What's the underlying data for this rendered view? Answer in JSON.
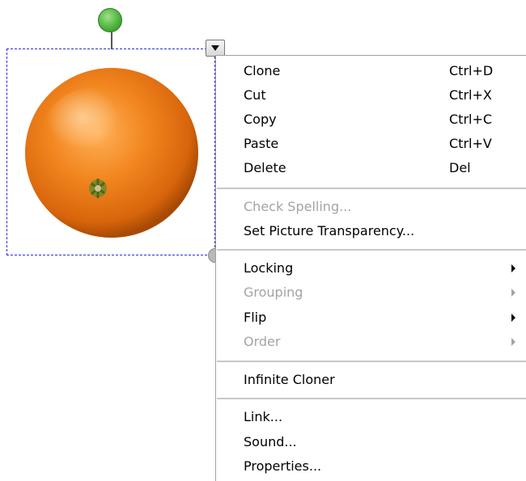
{
  "object": {
    "image": "orange-photo",
    "rotate_handle_color": "#4fb53c",
    "selection_color": "#2b2be0"
  },
  "context_menu": {
    "groups": [
      [
        {
          "label": "Clone",
          "shortcut": "Ctrl+D",
          "enabled": true
        },
        {
          "label": "Cut",
          "shortcut": "Ctrl+X",
          "enabled": true
        },
        {
          "label": "Copy",
          "shortcut": "Ctrl+C",
          "enabled": true
        },
        {
          "label": "Paste",
          "shortcut": "Ctrl+V",
          "enabled": true
        },
        {
          "label": "Delete",
          "shortcut": "Del",
          "enabled": true
        }
      ],
      [
        {
          "label": "Check Spelling...",
          "enabled": false
        },
        {
          "label": "Set Picture Transparency...",
          "enabled": true
        }
      ],
      [
        {
          "label": "Locking",
          "enabled": true,
          "submenu": true
        },
        {
          "label": "Grouping",
          "enabled": false,
          "submenu": true
        },
        {
          "label": "Flip",
          "enabled": true,
          "submenu": true
        },
        {
          "label": "Order",
          "enabled": false,
          "submenu": true
        }
      ],
      [
        {
          "label": "Infinite Cloner",
          "enabled": true
        }
      ],
      [
        {
          "label": "Link...",
          "enabled": true
        },
        {
          "label": "Sound...",
          "enabled": true
        },
        {
          "label": "Properties...",
          "enabled": true
        }
      ]
    ]
  }
}
